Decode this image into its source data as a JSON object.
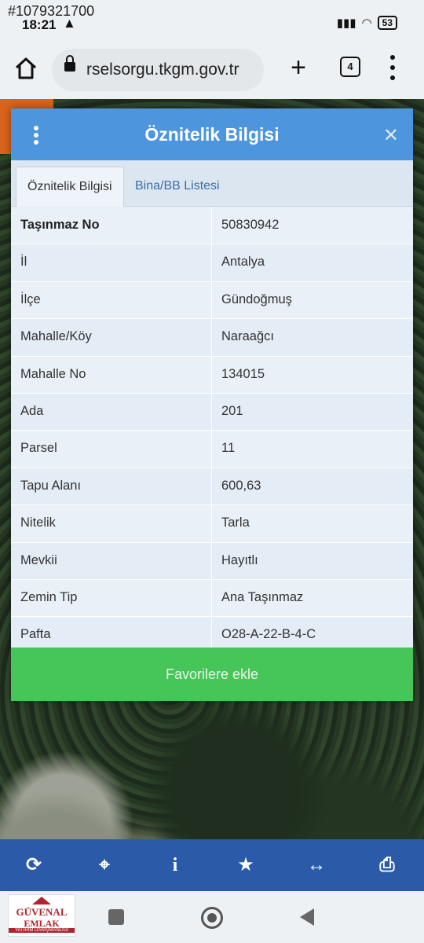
{
  "listing_id": "#1079321700",
  "status_bar": {
    "time": "18:21",
    "battery": "53"
  },
  "browser": {
    "url": "rselsorgu.tkgm.gov.tr",
    "tab_count": "4"
  },
  "dialog": {
    "title": "Öznitelik Bilgisi",
    "tabs": [
      {
        "label": "Öznitelik Bilgisi",
        "active": true
      },
      {
        "label": "Bina/BB Listesi",
        "active": false
      }
    ],
    "rows": [
      {
        "key": "Taşınmaz No",
        "value": "50830942"
      },
      {
        "key": "İl",
        "value": "Antalya"
      },
      {
        "key": "İlçe",
        "value": "Gündoğmuş"
      },
      {
        "key": "Mahalle/Köy",
        "value": "Naraağcı"
      },
      {
        "key": "Mahalle No",
        "value": "134015"
      },
      {
        "key": "Ada",
        "value": "201"
      },
      {
        "key": "Parsel",
        "value": "11"
      },
      {
        "key": "Tapu Alanı",
        "value": "600,63"
      },
      {
        "key": "Nitelik",
        "value": "Tarla"
      },
      {
        "key": "Mevkii",
        "value": "Hayıtlı"
      },
      {
        "key": "Zemin Tip",
        "value": "Ana Taşınmaz"
      },
      {
        "key": "Pafta",
        "value": "O28-A-22-B-4-C"
      }
    ],
    "favorite_button": "Favorilere ekle"
  },
  "map_toolbar": [
    "refresh-icon",
    "locate-icon",
    "info-icon",
    "star-icon",
    "measure-icon",
    "print-icon"
  ],
  "logo": {
    "name": "GÜVENAL",
    "sub": "EMLAK",
    "tag": "YATIRIM DANIŞMANLIĞI"
  },
  "colors": {
    "header": "#4d95dc",
    "favorite": "#46c658",
    "toolbar": "#2b5ba8"
  }
}
